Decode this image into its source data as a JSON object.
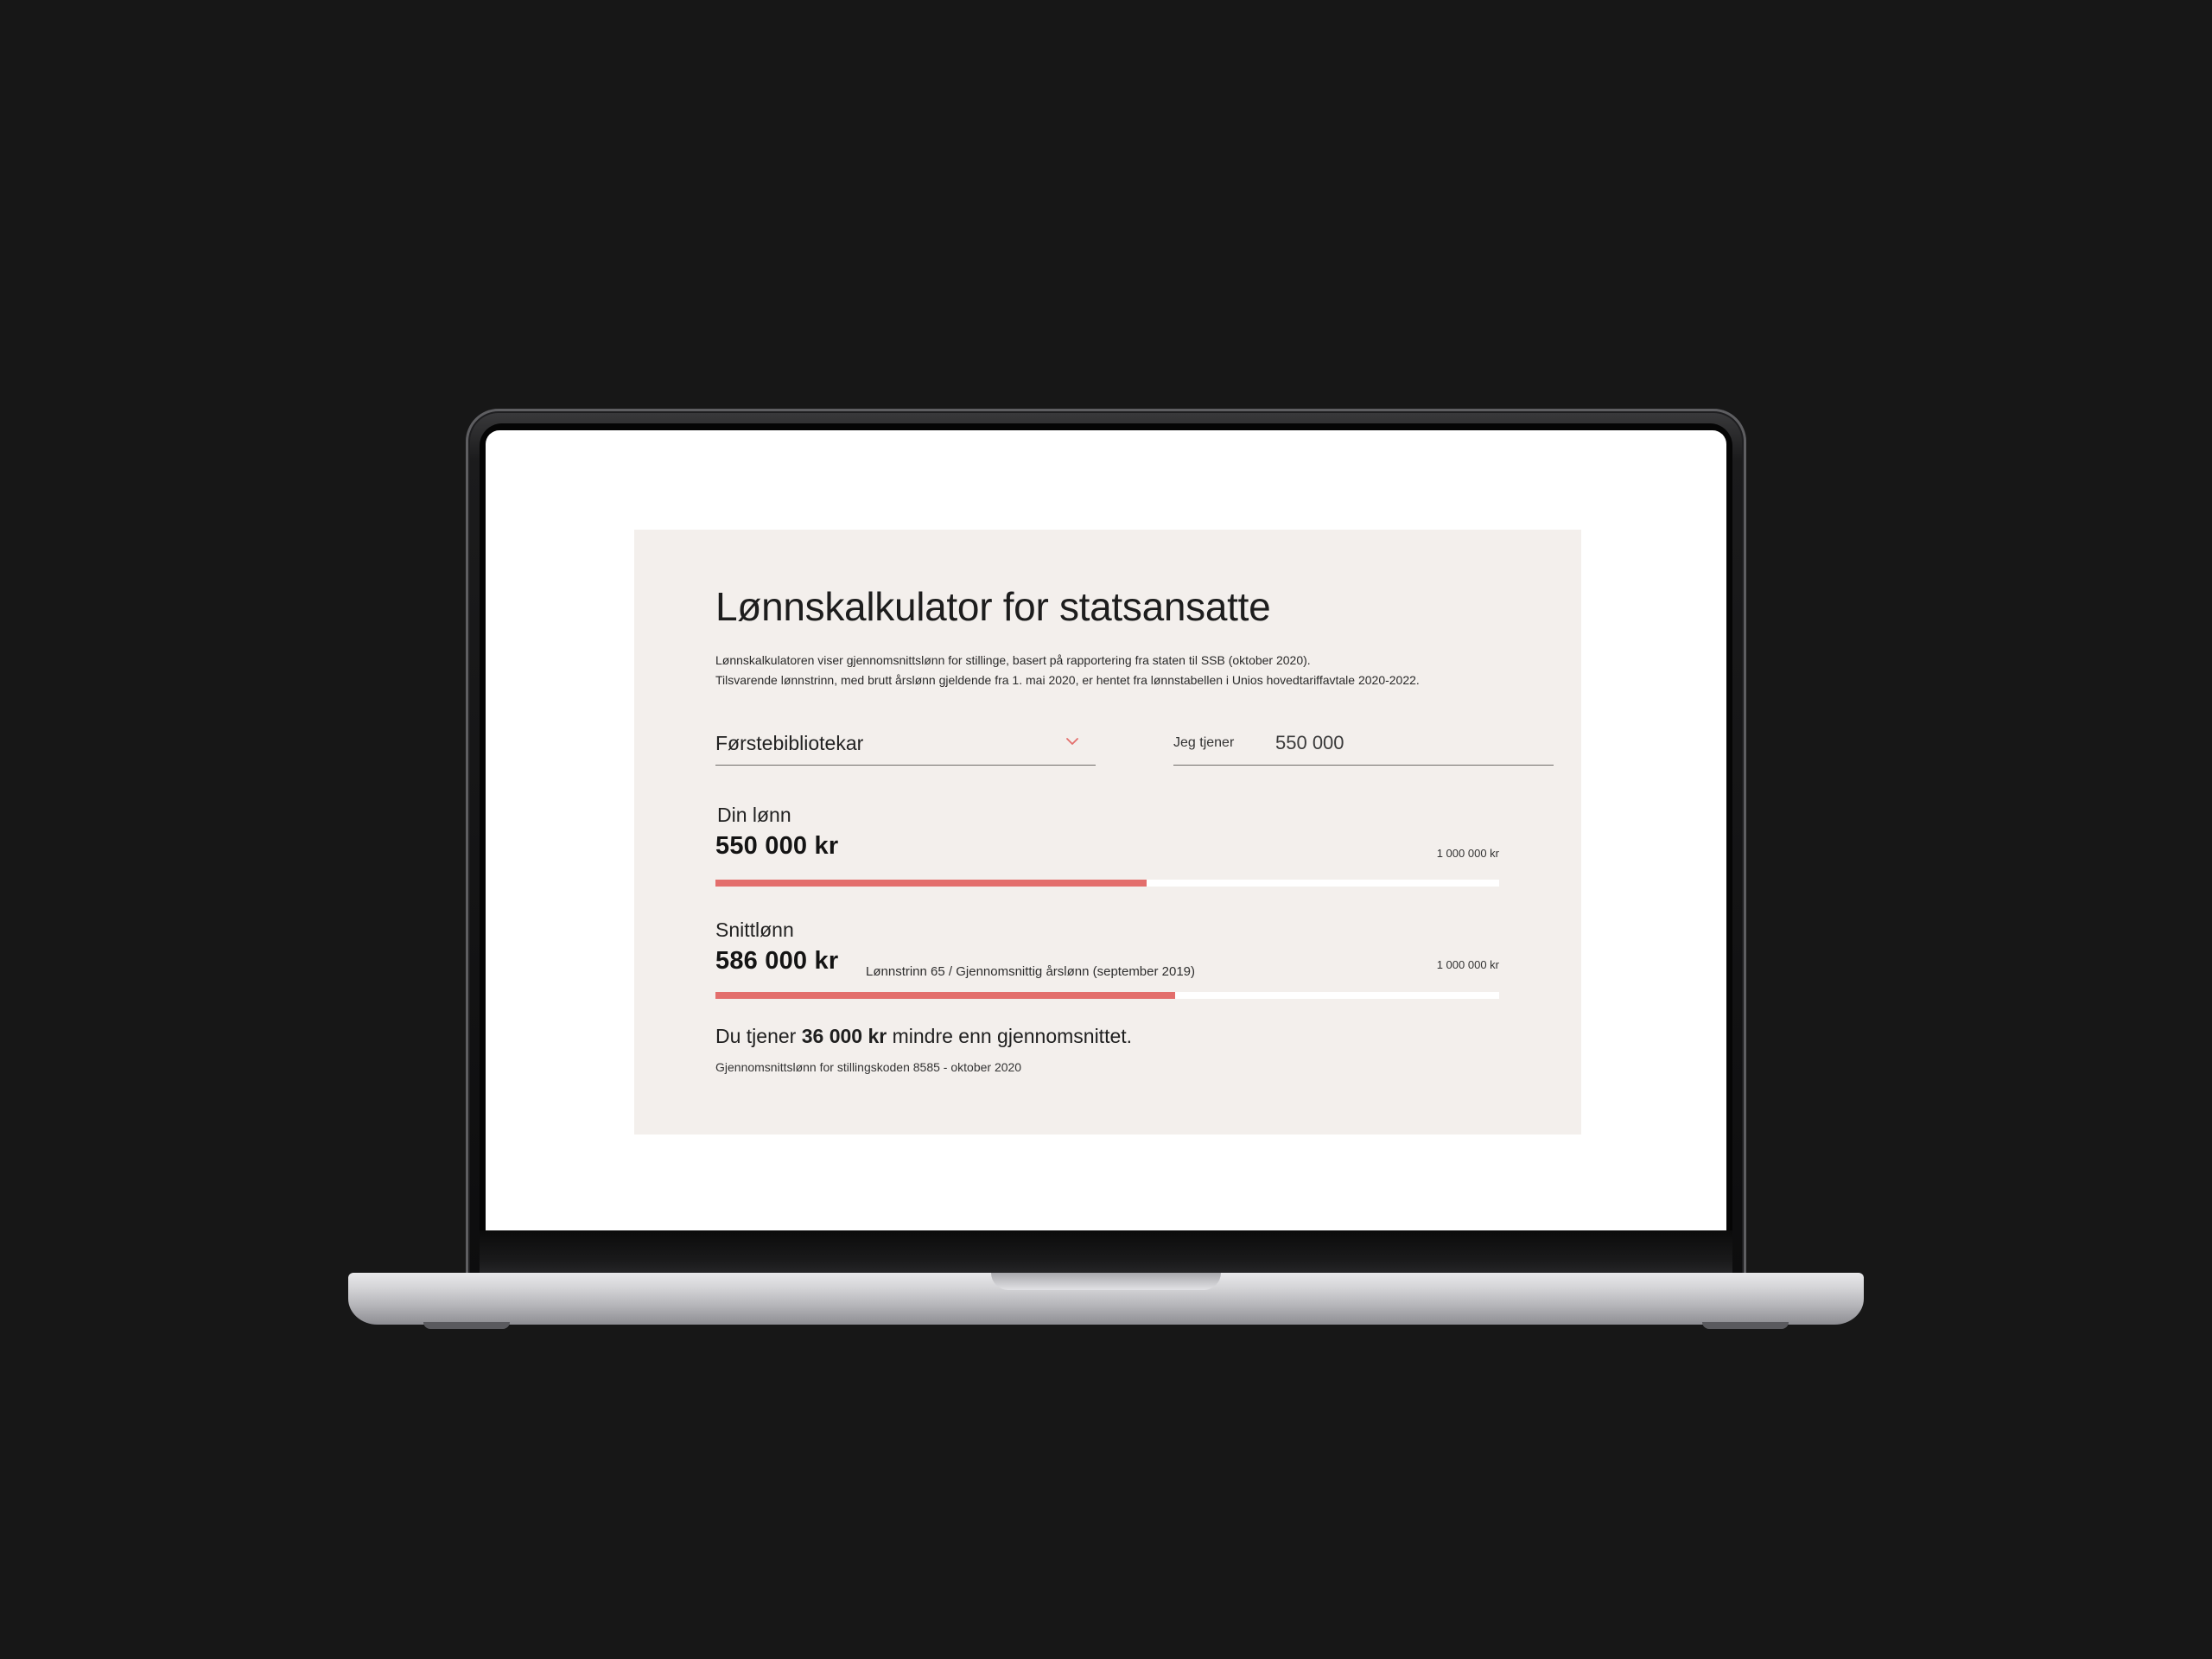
{
  "calculator": {
    "title": "Lønnskalkulator for statsansatte",
    "intro_line1": "Lønnskalkulatoren viser gjennomsnittslønn for stillinge, basert på rapportering fra staten til SSB (oktober 2020).",
    "intro_line2": "Tilsvarende lønnstrinn, med brutt årslønn gjeldende fra 1. mai 2020, er hentet fra lønnstabellen i Unios hovedtariffavtale 2020-2022.",
    "position_select": {
      "selected": "Førstebibliotekar"
    },
    "earnings": {
      "label": "Jeg tjener",
      "value": "550 000"
    },
    "your_salary": {
      "label": "Din lønn",
      "value": "550 000 kr",
      "max": "1 000 000 kr",
      "fraction": 0.55
    },
    "average_salary": {
      "label": "Snittlønn",
      "value": "586 000 kr",
      "note": "Lønnstrinn 65 / Gjennomsnittig årslønn (september 2019)",
      "max": "1 000 000 kr",
      "fraction": 0.586
    },
    "summary": {
      "prefix": "Du tjener ",
      "amount": "36 000 kr",
      "suffix": " mindre enn gjennomsnittet."
    },
    "footnote": "Gjennomsnittslønn for stillingskoden 8585 - oktober 2020"
  },
  "colors": {
    "accent": "#e36e6c",
    "card_background": "#f3efec",
    "page_background": "#171717"
  },
  "icons": {
    "select": "chevron-down-icon"
  }
}
